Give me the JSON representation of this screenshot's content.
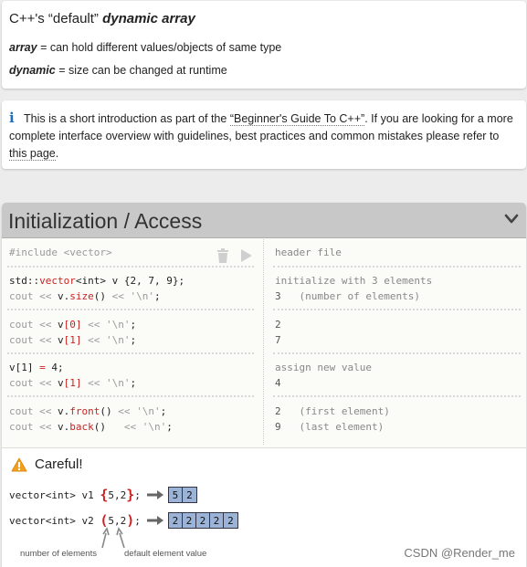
{
  "intro": {
    "title_prefix": "C++'s “default” ",
    "title_emph": "dynamic array",
    "def1_term": "array",
    "def1_text": " = can hold different values/objects of same type",
    "def2_term": "dynamic",
    "def2_text": " = size can be changed at runtime"
  },
  "note": {
    "icon": "info-icon",
    "text1": "This is a short introduction as part of the ",
    "link1": "“Beginner's Guide To C++”",
    "text2": ". If you are looking for a more complete interface overview with guidelines, best practices and common mistakes please refer to ",
    "link2": "this page",
    "text3": "."
  },
  "section": {
    "title": "Initialization / Access",
    "collapse_icon": "chevron-down-icon"
  },
  "code": {
    "include": "#include <vector>",
    "l_std": "std::",
    "l_vector": "vector",
    "l_int": "<int>",
    "l_v": " v ",
    "l_init": "{2, 7, 9}",
    "l_semi": ";",
    "cout": "cout",
    "shl": " << ",
    "v_size": "v.",
    "size_fn": "size",
    "parens": "()",
    "nl": "'\\n'",
    "semi": ";",
    "v0_v": "v",
    "v0_idx": "[0]",
    "v1_idx": "[1]",
    "assign_lhs": "v[1]",
    "assign_op": " = ",
    "assign_val": "4",
    "front_fn": "front",
    "back_fn": "back",
    "back_pad": "  "
  },
  "results": {
    "r1": "header file",
    "r2": "initialize with 3 elements",
    "r3_val": "3",
    "r3_note": "   (number of elements)",
    "r4": "2",
    "r5": "7",
    "r6": "assign new value",
    "r7": "4",
    "r8_val": "2",
    "r8_note": "   (first element)",
    "r9_val": "9",
    "r9_note": "   (last element)"
  },
  "careful": {
    "title": "Careful!",
    "ex1_decl": "vector<int> v1 ",
    "ex1_open": "{",
    "ex1_args": "5,2",
    "ex1_close": "}",
    "ex1_semi": ";",
    "ex1_cells": [
      "5",
      "2"
    ],
    "ex2_decl": "vector<int> v2 ",
    "ex2_open": "(",
    "ex2_args": "5,2",
    "ex2_close": ")",
    "ex2_semi": ";",
    "ex2_cells": [
      "2",
      "2",
      "2",
      "2",
      "2"
    ],
    "label_count": "number of elements",
    "label_default": "default element value"
  },
  "watermark": "CSDN @Render_me"
}
